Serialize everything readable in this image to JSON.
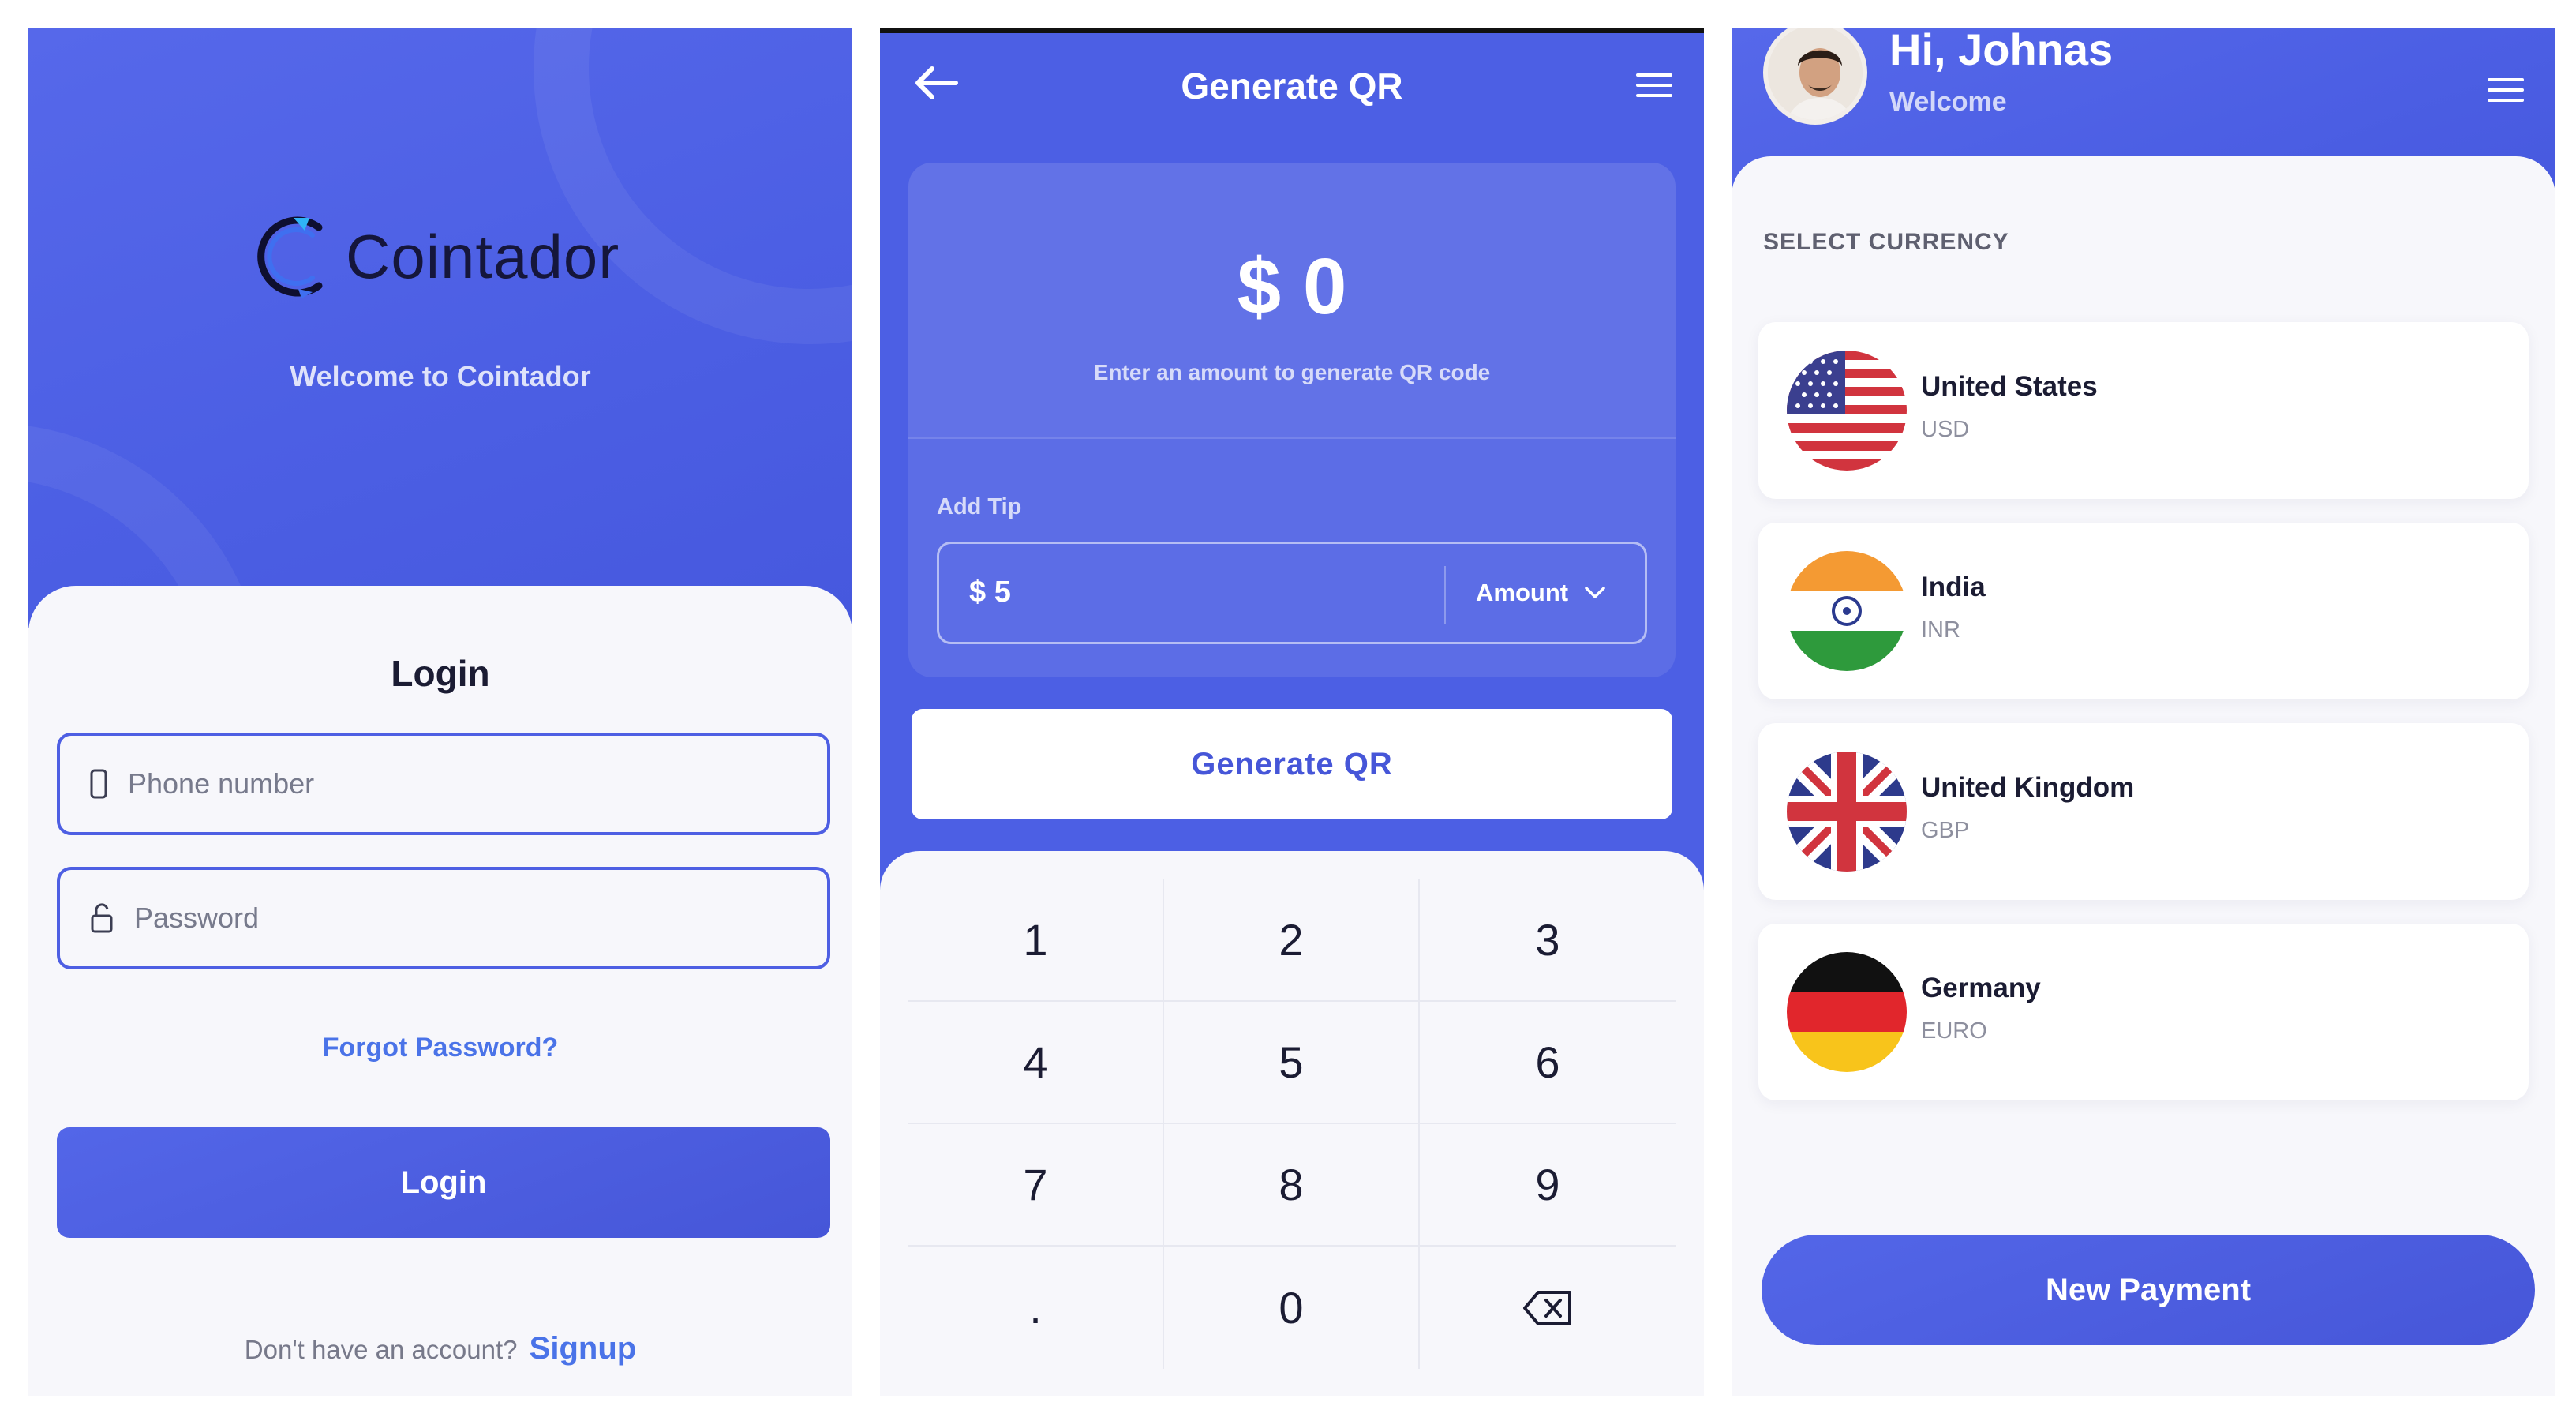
{
  "login": {
    "brand": "Cointador",
    "welcome": "Welcome to Cointador",
    "title": "Login",
    "phone_placeholder": "Phone number",
    "password_placeholder": "Password",
    "forgot": "Forgot Password?",
    "login_button": "Login",
    "signup_prompt": "Don't have an account?",
    "signup_link": "Signup"
  },
  "generate_qr": {
    "title": "Generate QR",
    "amount": "$ 0",
    "hint": "Enter an amount to generate QR code",
    "tip_label": "Add Tip",
    "tip_value": "$ 5",
    "tip_mode": "Amount",
    "button": "Generate QR",
    "keypad": [
      "1",
      "2",
      "3",
      "4",
      "5",
      "6",
      "7",
      "8",
      "9",
      ".",
      "0",
      "backspace-icon"
    ]
  },
  "currency": {
    "greeting": "Hi, Johnas",
    "welcome": "Welcome",
    "section_label": "SELECT CURRENCY",
    "items": [
      {
        "name": "United States",
        "code": "USD",
        "flag": "us-flag-icon"
      },
      {
        "name": "India",
        "code": "INR",
        "flag": "india-flag-icon"
      },
      {
        "name": "United Kingdom",
        "code": "GBP",
        "flag": "uk-flag-icon"
      },
      {
        "name": "Germany",
        "code": "EURO",
        "flag": "germany-flag-icon"
      }
    ],
    "button": "New Payment"
  },
  "colors": {
    "primary": "#4c5fe4",
    "link": "#4a73e8",
    "background": "#f7f7fb",
    "text": "#1b1c33"
  }
}
